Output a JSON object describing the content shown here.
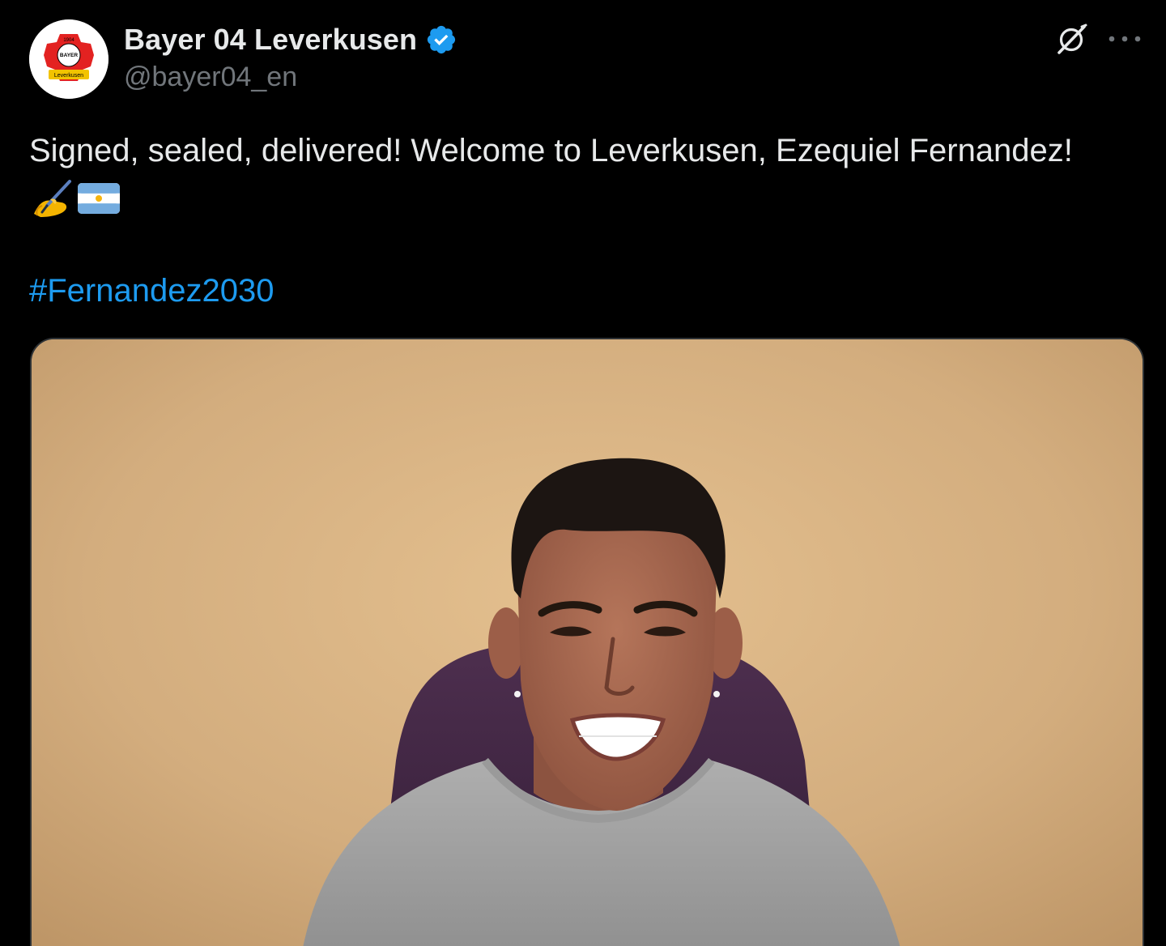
{
  "author": {
    "display_name": "Bayer 04 Leverkusen",
    "handle": "@bayer04_en",
    "verified": true,
    "avatar_logo_text": [
      "1904",
      "BAYER",
      "Leverkusen"
    ]
  },
  "post": {
    "text": "Signed, sealed, delivered! Welcome to Leverkusen, Ezequiel Fernandez!",
    "emojis": [
      "writing-hand",
      "argentina-flag"
    ],
    "hashtag": "#Fernandez2030"
  },
  "media": {
    "type": "photo",
    "subject": "smiling player in grey sweater seated in purple chair"
  },
  "colors": {
    "background": "#000000",
    "text": "#e7e9ea",
    "secondary_text": "#71767b",
    "link": "#1d9bf0",
    "verified": "#1d9bf0",
    "media_border": "#2f3336"
  }
}
